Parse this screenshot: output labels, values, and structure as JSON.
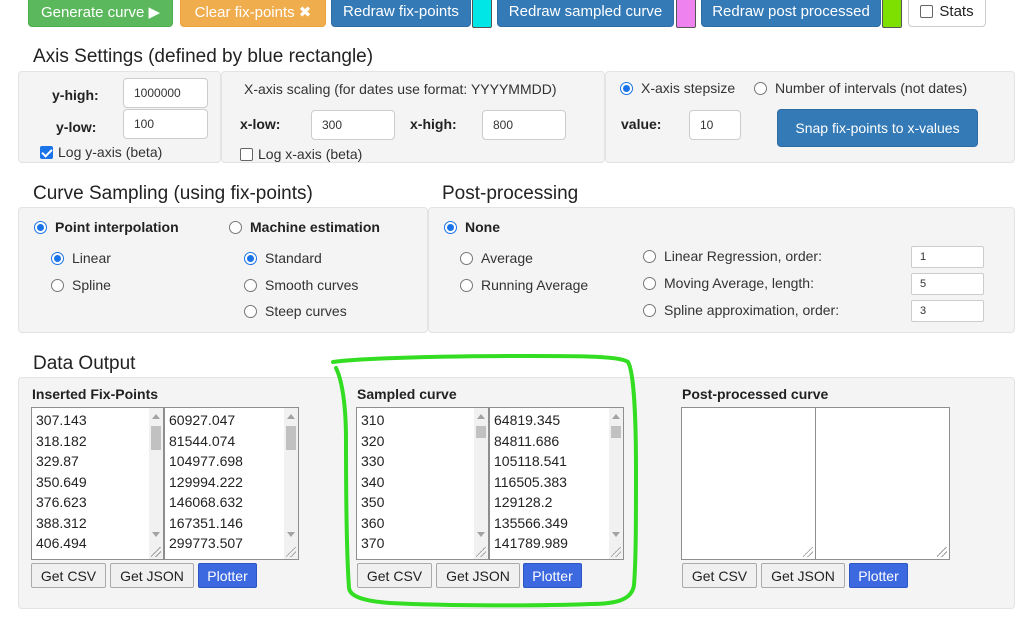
{
  "toolbar": {
    "generate": "Generate curve ▶",
    "clear": "Clear fix-points ✖",
    "redraw_fix": "Redraw fix-points",
    "redraw_sampled": "Redraw sampled curve",
    "redraw_post": "Redraw post processed",
    "stats": "Stats",
    "swatch_colors": {
      "fix": "#00e5e5",
      "sampled": "#ee82ee",
      "post": "#7ee000"
    }
  },
  "axis": {
    "title": "Axis Settings (defined by blue rectangle)",
    "y_high_label": "y-high:",
    "y_high_value": "1000000",
    "y_low_label": "y-low:",
    "y_low_value": "100",
    "log_y": "Log y-axis (beta)",
    "x_scaling_caption": "X-axis scaling (for dates use format: YYYYMMDD)",
    "x_low_label": "x-low:",
    "x_low_value": "300",
    "x_high_label": "x-high:",
    "x_high_value": "800",
    "log_x": "Log x-axis (beta)",
    "stepsize_option": "X-axis stepsize",
    "intervals_option": "Number of intervals (not dates)",
    "value_label": "value:",
    "value": "10",
    "snap_button": "Snap fix-points to x-values"
  },
  "sampling": {
    "title": "Curve Sampling (using fix-points)",
    "point_interp": "Point interpolation",
    "linear": "Linear",
    "spline": "Spline",
    "machine": "Machine estimation",
    "standard": "Standard",
    "smooth": "Smooth curves",
    "steep": "Steep curves"
  },
  "post": {
    "title": "Post-processing",
    "none": "None",
    "average": "Average",
    "running": "Running Average",
    "linreg": "Linear Regression, order:",
    "linreg_value": "1",
    "moving": "Moving Average, length:",
    "moving_value": "5",
    "splineapprox": "Spline approximation, order:",
    "splineapprox_value": "3"
  },
  "output": {
    "title": "Data Output",
    "fix_title": "Inserted Fix-Points",
    "fix_x": [
      "307.143",
      "318.182",
      "329.87",
      "350.649",
      "376.623",
      "388.312",
      "406.494"
    ],
    "fix_y": [
      "60927.047",
      "81544.074",
      "104977.698",
      "129994.222",
      "146068.632",
      "167351.146",
      "299773.507"
    ],
    "sampled_title": "Sampled curve",
    "sampled_x": [
      "310",
      "320",
      "330",
      "340",
      "350",
      "360",
      "370"
    ],
    "sampled_y": [
      "64819.345",
      "84811.686",
      "105118.541",
      "116505.383",
      "129128.2",
      "135566.349",
      "141789.989"
    ],
    "post_title": "Post-processed curve",
    "get_csv": "Get CSV",
    "get_json": "Get JSON",
    "plotter": "Plotter"
  },
  "annotation_color": "#33dd22"
}
